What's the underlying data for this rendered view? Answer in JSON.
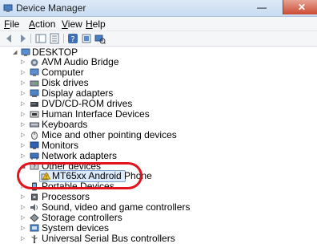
{
  "window": {
    "title": "Device Manager"
  },
  "menu": {
    "items": [
      {
        "label": "File",
        "accel": "F",
        "rest": "ile"
      },
      {
        "label": "Action",
        "accel": "A",
        "rest": "ction"
      },
      {
        "label": "View",
        "accel": "V",
        "rest": "iew"
      },
      {
        "label": "Help",
        "accel": "H",
        "rest": "elp"
      }
    ]
  },
  "tree": {
    "root": "DESKTOP",
    "items": [
      "AVM Audio Bridge",
      "Computer",
      "Disk drives",
      "Display adapters",
      "DVD/CD-ROM drives",
      "Human Interface Devices",
      "Keyboards",
      "Mice and other pointing devices",
      "Monitors",
      "Network adapters",
      "Other devices",
      "MT65xx Android Phone",
      "Portable Devices",
      "Processors",
      "Sound, video and game controllers",
      "Storage controllers",
      "System devices",
      "Universal Serial Bus controllers"
    ]
  }
}
